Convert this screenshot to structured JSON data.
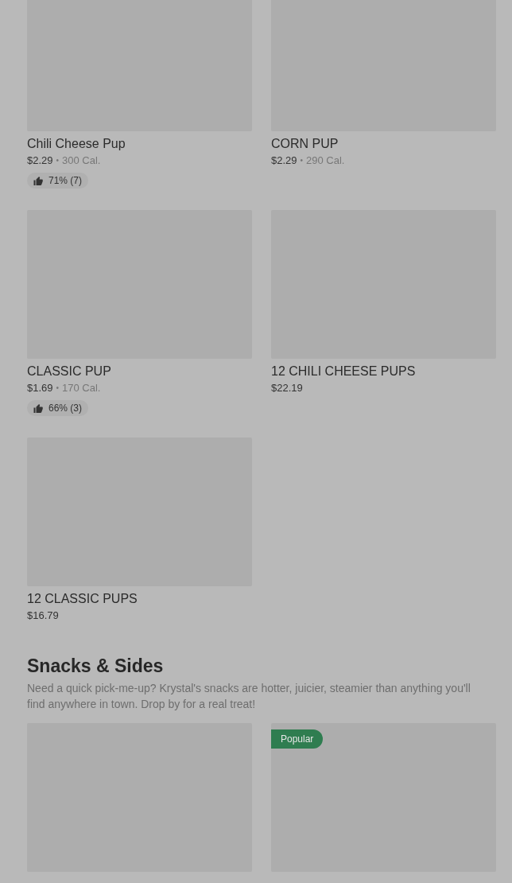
{
  "sections": [
    {
      "items": [
        {
          "name": "Chili Cheese Pup",
          "price": "$2.29",
          "separator": "•",
          "calories": "300 Cal.",
          "rating": "71% (7)"
        },
        {
          "name": "CORN PUP",
          "price": "$2.29",
          "separator": "•",
          "calories": "290 Cal."
        },
        {
          "name": "CLASSIC PUP",
          "price": "$1.69",
          "separator": "•",
          "calories": "170 Cal.",
          "rating": "66% (3)"
        },
        {
          "name": "12 CHILI CHEESE PUPS",
          "price": "$22.19"
        },
        {
          "name": "12 CLASSIC PUPS",
          "price": "$16.79"
        }
      ]
    },
    {
      "title": "Snacks & Sides",
      "description": "Need a quick pick-me-up? Krystal's snacks are hotter, juicier, steamier than anything you'll find anywhere in town. Drop by for a real treat!",
      "items": [
        {
          "kind": "picture"
        },
        {
          "kind": "picture",
          "tag": "Popular"
        }
      ]
    }
  ]
}
